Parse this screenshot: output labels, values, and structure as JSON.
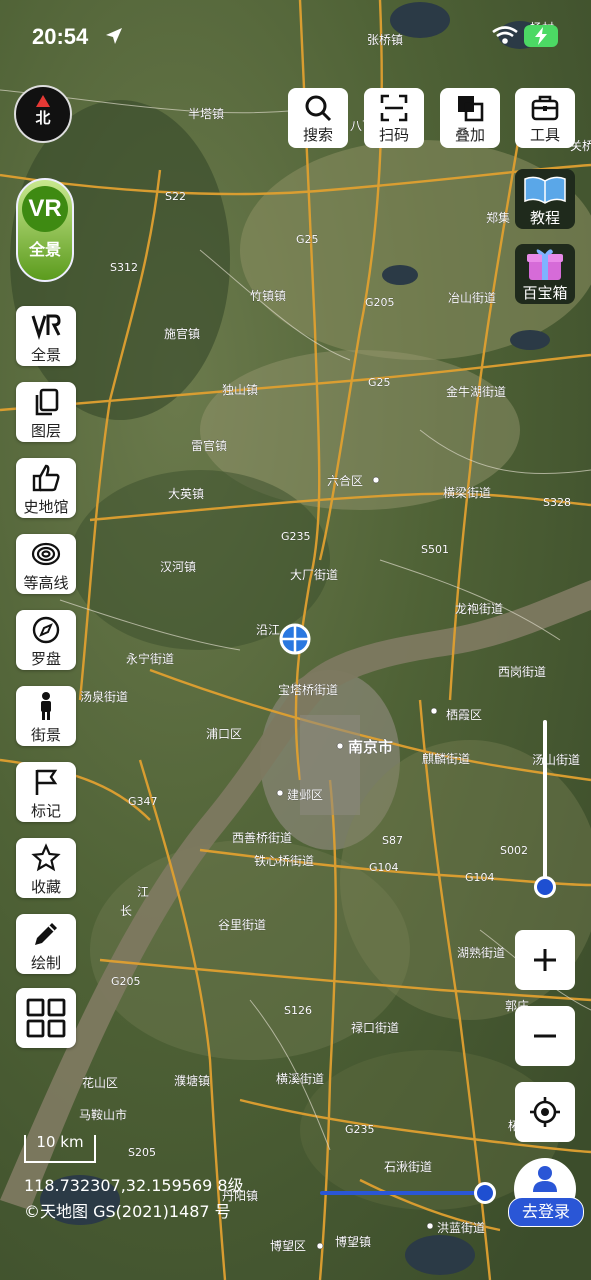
{
  "status_bar": {
    "time": "20:54"
  },
  "compass": {
    "label": "北"
  },
  "vr_panorama": {
    "badge": "VR",
    "label": "全景"
  },
  "top_tools": [
    {
      "label": "搜索",
      "icon": "search-icon"
    },
    {
      "label": "扫码",
      "icon": "scan-icon"
    },
    {
      "label": "叠加",
      "icon": "overlay-icon"
    },
    {
      "label": "工具",
      "icon": "toolbox-icon"
    }
  ],
  "right_extras": [
    {
      "label": "教程",
      "icon": "book-icon"
    },
    {
      "label": "百宝箱",
      "icon": "gift-icon"
    }
  ],
  "left_tools": [
    {
      "label": "全景",
      "icon": "vr-icon"
    },
    {
      "label": "图层",
      "icon": "layers-icon"
    },
    {
      "label": "史地馆",
      "icon": "thumbs-up-icon"
    },
    {
      "label": "等高线",
      "icon": "contour-icon"
    },
    {
      "label": "罗盘",
      "icon": "compass-icon"
    },
    {
      "label": "街景",
      "icon": "person-icon"
    },
    {
      "label": "标记",
      "icon": "flag-icon"
    },
    {
      "label": "收藏",
      "icon": "star-icon"
    },
    {
      "label": "绘制",
      "icon": "pencil-icon"
    },
    {
      "label": "",
      "icon": "grid-icon"
    }
  ],
  "zoom": {
    "in": "+",
    "out": "−"
  },
  "scale_bar": "10 km",
  "coordinates": "118.732307,32.159569 8级",
  "copyright": "©天地图 GS(2021)1487 号",
  "login": {
    "label": "去登录"
  },
  "map_labels": [
    "张桥镇",
    "杨村",
    "半塔镇",
    "关桥",
    "八百",
    "郑集",
    "S22",
    "G25",
    "S312",
    "G205",
    "冶山街道",
    "竹镇镇",
    "施官镇",
    "G25",
    "金牛湖街道",
    "独山镇",
    "雷官镇",
    "六合区",
    "横梁街道",
    "S328",
    "大英镇",
    "G235",
    "S501",
    "汉河镇",
    "大厂街道",
    "龙袍街道",
    "沿江",
    "永宁街道",
    "宝塔桥街道",
    "西岗街道",
    "汤泉街道",
    "栖霞区",
    "浦口区",
    "南京市",
    "麒麟街道",
    "汤山街道",
    "建邺区",
    "G347",
    "S87",
    "西善桥街道",
    "铁心桥街道",
    "G104",
    "S002",
    "G104",
    "谷里街道",
    "湖熟街道",
    "G205",
    "S126",
    "禄口街道",
    "郭庄",
    "花山区",
    "濮塘镇",
    "横溪街道",
    "马鞍山市",
    "G235",
    "柘塘",
    "S205",
    "石湫街道",
    "丹阳镇",
    "洪蓝街道",
    "博望区",
    "博望镇",
    "长",
    "江"
  ]
}
